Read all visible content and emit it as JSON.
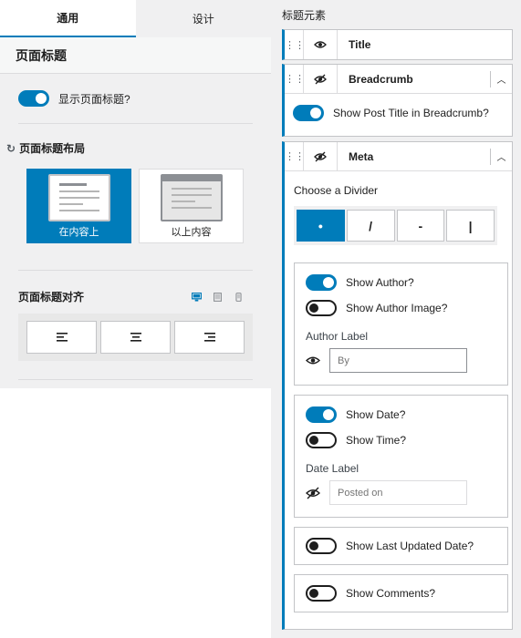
{
  "left": {
    "tabs": [
      {
        "label": "通用"
      },
      {
        "label": "设计"
      }
    ],
    "panel_title": "页面标题",
    "show_title_label": "显示页面标题?",
    "layout": {
      "title": "页面标题布局",
      "reset_glyph": "↻",
      "options": [
        {
          "label": "在内容上",
          "selected": true
        },
        {
          "label": "以上内容",
          "selected": false
        }
      ]
    },
    "alignment": {
      "title": "页面标题对齐",
      "devices": [
        "desktop-icon",
        "tablet-icon",
        "mobile-icon"
      ]
    }
  },
  "right": {
    "header": "标题元素",
    "elements": [
      {
        "title": "Title",
        "visible": true
      },
      {
        "title": "Breadcrumb",
        "visible": false,
        "toggle_label": "Show Post Title in Breadcrumb?"
      },
      {
        "title": "Meta",
        "visible": false
      }
    ],
    "meta": {
      "divider_label": "Choose a Divider",
      "dividers": [
        "•",
        "/",
        "-",
        "|"
      ],
      "show_author": "Show Author?",
      "show_author_image": "Show Author Image?",
      "author_label": "Author Label",
      "author_placeholder": "By",
      "show_date": "Show Date?",
      "show_time": "Show Time?",
      "date_label": "Date Label",
      "date_placeholder": "Posted on",
      "show_updated": "Show Last Updated Date?",
      "show_comments": "Show Comments?"
    }
  },
  "colors": {
    "accent": "#007cba",
    "panel_bg": "#f0f0f1"
  }
}
